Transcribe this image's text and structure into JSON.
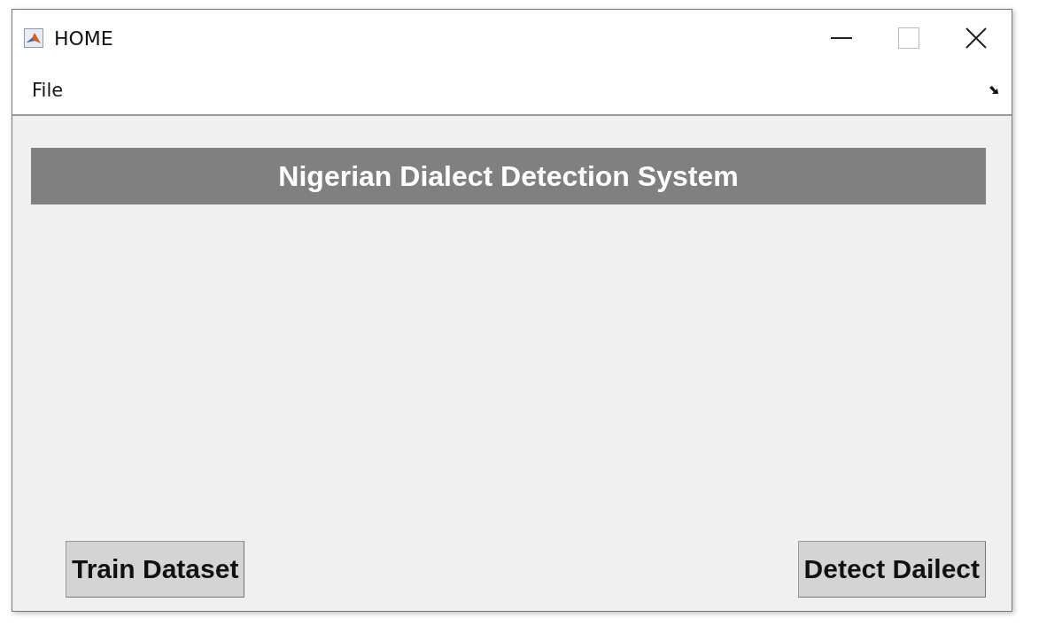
{
  "window": {
    "title": "HOME"
  },
  "menu": [
    "File"
  ],
  "banner": {
    "text": "Nigerian Dialect Detection System"
  },
  "buttons": [
    "Train Dataset",
    "Detect Dailect"
  ]
}
